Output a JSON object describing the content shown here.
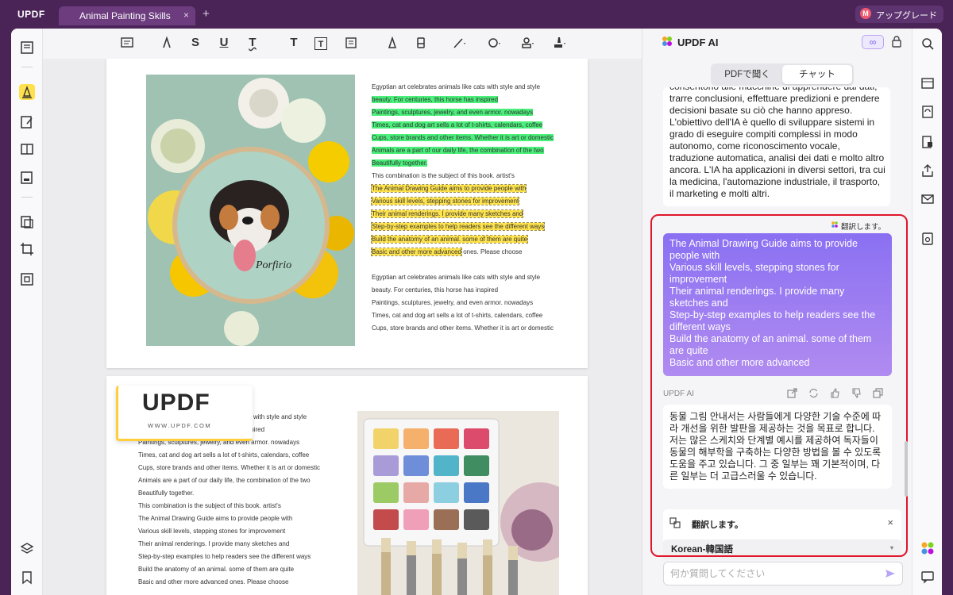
{
  "app": {
    "logo": "UPDF",
    "tab_title": "Animal Painting Skills",
    "tab_close": "×",
    "tab_add": "+",
    "upgrade_avatar": "M",
    "upgrade_label": "アップグレード"
  },
  "toolbar": {
    "text_T": "T",
    "text_S": "S",
    "text_U": "U",
    "text_T2": "T",
    "text_bold_T": "T",
    "text_box_T": "T"
  },
  "document": {
    "page1_plain_top": "Egyptian art celebrates animals like cats with style and style",
    "page1_green": [
      "beauty. For centuries, this horse has inspired",
      "Paintings, sculptures, jewelry, and even armor. nowadays",
      "Times, cat and dog art sells a lot of t-shirts, calendars, coffee",
      "Cups, store brands and other items. Whether it is art or domestic",
      "Animals are a part of our daily life, the combination of the two",
      "Beautifully together."
    ],
    "page1_plain_mid": "This combination is the subject of this book. artist's",
    "page1_yellow": [
      "The Animal Drawing Guide aims to provide people with",
      "Various skill levels, stepping stones for improvement",
      "Their animal renderings. I provide many sketches and",
      "Step-by-step examples to help readers see the different ways",
      "Build the anatomy of an animal. some of them are quite",
      "Basic and other more advanced"
    ],
    "page1_yellow_tail": " ones. Please choose",
    "page1_bottom": [
      "Egyptian art celebrates animals like cats with style and style",
      "beauty. For centuries, this horse has inspired",
      "Paintings, sculptures, jewelry, and even armor. nowadays",
      "Times, cat and dog art sells a lot of t-shirts, calendars, coffee",
      "Cups, store brands and other items. Whether it is art or domestic"
    ],
    "page2_lines": [
      "Egyptian art celebrates animals like cats with style and style",
      "beauty. For centuries, this horse has inspired",
      "Paintings, sculptures, jewelry, and even armor. nowadays",
      "Times, cat and dog art sells a lot of t-shirts, calendars, coffee",
      "Cups, store brands and other items. Whether it is art or domestic",
      "Animals are a part of our daily life, the combination of the two",
      "Beautifully together.",
      "This combination is the subject of this book. artist's",
      "The Animal Drawing Guide aims to provide people with",
      "Various skill levels, stepping stones for improvement",
      "Their animal renderings. I provide many sketches and",
      "Step-by-step examples to help readers see the different ways",
      "Build the anatomy of an animal. some of them are quite",
      "Basic and other more advanced ones. Please choose"
    ],
    "photo1_signature": "Porfirio",
    "stamp_name": "UPDF",
    "stamp_url": "WWW.UPDF.COM"
  },
  "ai_panel": {
    "title": "UPDF AI",
    "infinity": "∞",
    "tabs": [
      {
        "label": "PDFで聞く",
        "active": false
      },
      {
        "label": "チャット",
        "active": true
      }
    ],
    "italian_text": "consentono alle macchine di apprendere dai dati, trarre conclusioni, effettuare predizioni e prendere decisioni basate su ciò che hanno appreso. L'obiettivo dell'IA è quello di sviluppare sistemi in grado di eseguire compiti complessi in modo autonomo, come riconoscimento vocale, traduzione automatica, analisi dei dati e molto altro ancora. L'IA ha applicazioni in diversi settori, tra cui la medicina, l'automazione industriale, il trasporto, il marketing e molti altri.",
    "translate_tag": "翻訳します。",
    "user_message": [
      "The Animal Drawing Guide aims to provide people with",
      "Various skill levels, stepping stones for improvement",
      "Their animal renderings. I provide many sketches and",
      "Step-by-step examples to help readers see the different ways",
      "Build the anatomy of an animal. some of them are quite",
      "Basic and other more advanced"
    ],
    "ai_label": "UPDF AI",
    "answer": "동물 그림 안내서는 사람들에게 다양한 기술 수준에 따라 개선을 위한 발판을 제공하는 것을 목표로 합니다. 저는 많은 스케치와 단계별 예시를 제공하여 독자들이 동물의 해부학을 구축하는 다양한 방법을 볼 수 있도록 도움을 주고 있습니다. 그 중 일부는 꽤 기본적이며, 다른 일부는 더 고급스러울 수 있습니다.",
    "translate_card_title": "翻訳します。",
    "translate_close": "×",
    "language": "Korean-韓国語",
    "language_caret": "▾",
    "input_placeholder": "何か質問してください"
  },
  "colors": {
    "accent": "#8a70f2",
    "highlight_green": "#4af07a",
    "highlight_yellow": "#ffe34d",
    "frame": "#e0162b",
    "titlebar": "#4a2456"
  }
}
